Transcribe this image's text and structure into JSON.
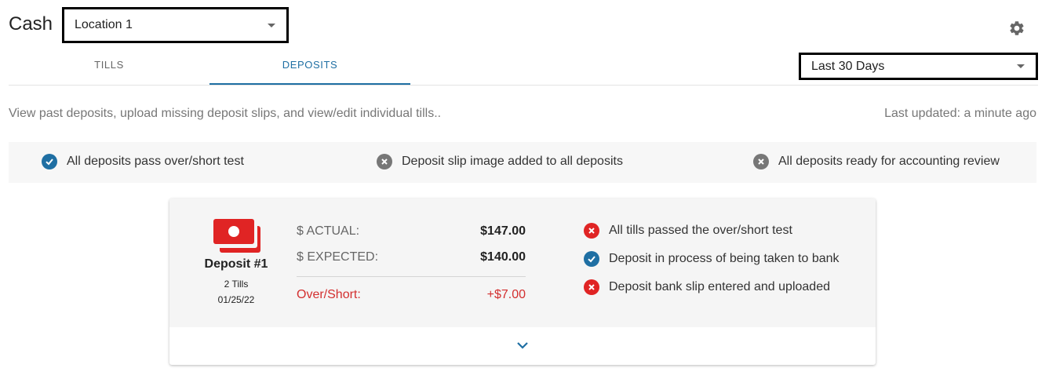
{
  "header": {
    "title": "Cash",
    "location_select": "Location 1",
    "date_range_select": "Last 30 Days"
  },
  "tabs": [
    {
      "label": "TILLS",
      "active": false
    },
    {
      "label": "DEPOSITS",
      "active": true
    }
  ],
  "description": "View past deposits, upload missing deposit slips, and view/edit individual tills..",
  "last_updated": "Last updated: a minute ago",
  "summary_checks": [
    {
      "label": "All deposits pass over/short test",
      "status": "pass",
      "icon": "check-circle-icon"
    },
    {
      "label": "Deposit slip image added to all deposits",
      "status": "fail",
      "icon": "x-circle-icon"
    },
    {
      "label": "All deposits ready for accounting review",
      "status": "fail",
      "icon": "x-circle-icon"
    }
  ],
  "deposit": {
    "name": "Deposit #1",
    "tills": "2 Tills",
    "date": "01/25/22",
    "actual_label": "$ ACTUAL:",
    "actual_value": "$147.00",
    "expected_label": "$ EXPECTED:",
    "expected_value": "$140.00",
    "over_short_label": "Over/Short:",
    "over_short_value": "+$7.00",
    "statuses": [
      {
        "label": "All tills passed the over/short test",
        "status": "fail"
      },
      {
        "label": "Deposit in process of being taken to bank",
        "status": "pass"
      },
      {
        "label": "Deposit bank slip entered and uploaded",
        "status": "fail"
      }
    ]
  },
  "colors": {
    "accent_blue": "#1f6fa3",
    "error_red": "#e02424",
    "neutral_gray": "#777777"
  }
}
